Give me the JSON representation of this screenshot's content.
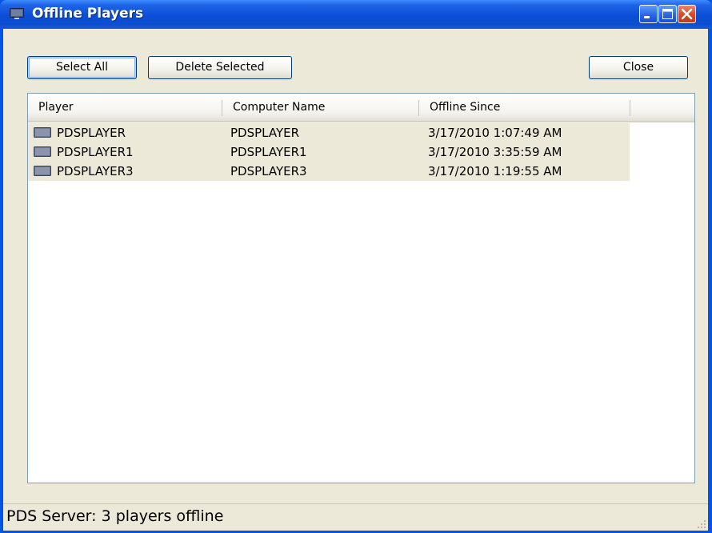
{
  "window": {
    "title": "Offline Players",
    "title_icon": "monitor-icon",
    "controls": {
      "minimize": "minimize-icon",
      "maximize": "maximize-icon",
      "close": "close-icon"
    }
  },
  "toolbar": {
    "select_all_label": "Select All",
    "delete_selected_label": "Delete Selected",
    "close_label": "Close"
  },
  "list": {
    "columns": [
      "Player",
      "Computer Name",
      "Offline Since"
    ],
    "rows": [
      {
        "player": "PDSPLAYER",
        "computer": "PDSPLAYER",
        "offline_since": "3/17/2010 1:07:49 AM",
        "icon": "player-icon"
      },
      {
        "player": "PDSPLAYER1",
        "computer": "PDSPLAYER1",
        "offline_since": "3/17/2010 3:35:59 AM",
        "icon": "player-icon"
      },
      {
        "player": "PDSPLAYER3",
        "computer": "PDSPLAYER3",
        "offline_since": "3/17/2010 1:19:55 AM",
        "icon": "player-icon"
      }
    ]
  },
  "status": {
    "text": "PDS Server: 3 players offline"
  },
  "colors": {
    "titlebar": "#0a4ed6",
    "window_face": "#ece9d8",
    "row_highlight": "#ece9d8",
    "list_border": "#7f9db9"
  }
}
